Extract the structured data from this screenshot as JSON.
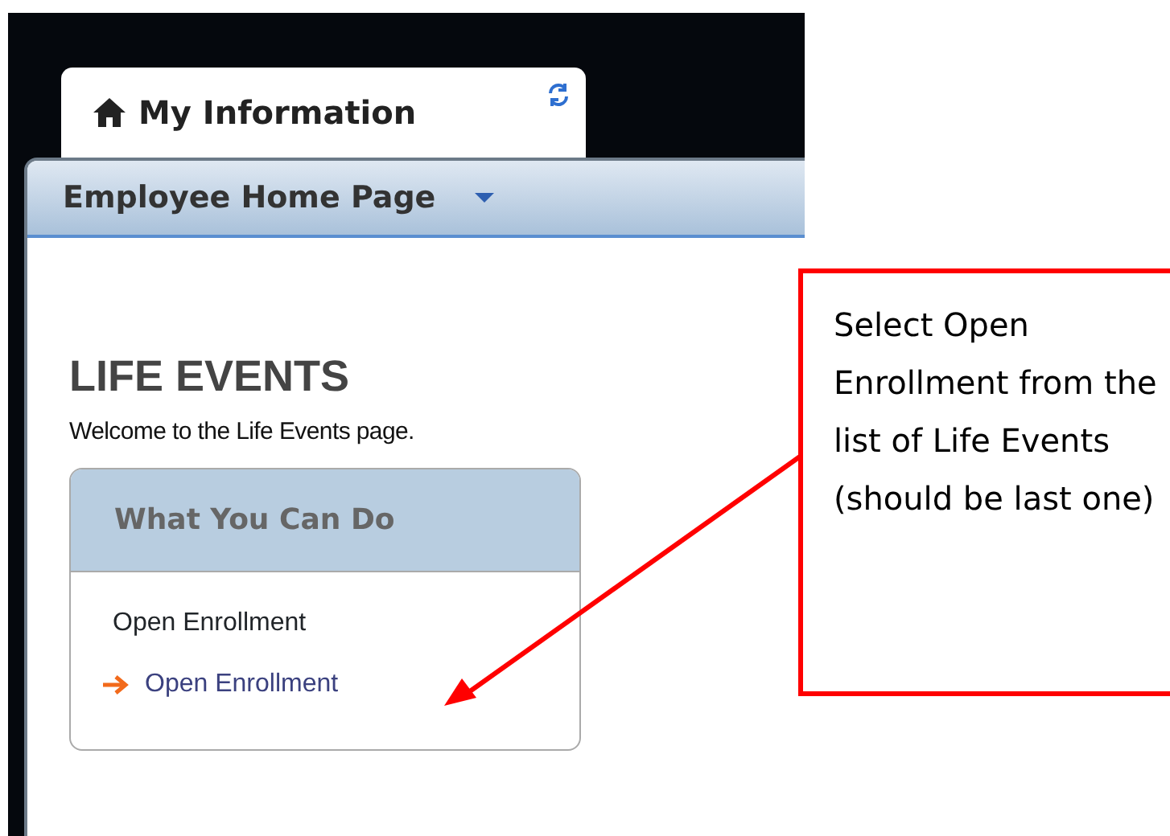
{
  "tab": {
    "label": "My Information"
  },
  "header": {
    "title": "Employee Home Page"
  },
  "page": {
    "title": "LIFE EVENTS",
    "welcome": "Welcome to the Life Events page."
  },
  "actions_box": {
    "title": "What You Can Do",
    "items": [
      {
        "kind": "text",
        "label": "Open Enrollment"
      },
      {
        "kind": "link",
        "label": "Open Enrollment"
      }
    ]
  },
  "callout": {
    "text": "Select Open Enrollment from the list of Life Events (should be last one)"
  }
}
